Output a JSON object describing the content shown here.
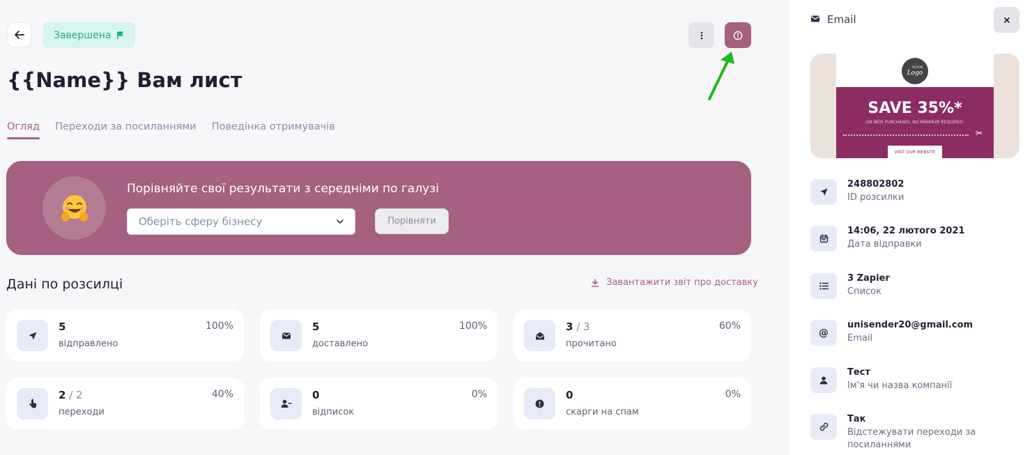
{
  "header": {
    "status": "Завершена",
    "title": "{{Name}} Вам лист"
  },
  "tabs": [
    {
      "label": "Огляд",
      "active": true
    },
    {
      "label": "Переходи за посиланнями",
      "active": false
    },
    {
      "label": "Поведінка отримувачів",
      "active": false
    }
  ],
  "banner": {
    "title": "Порівняйте свої результати з середніми по галузі",
    "select_placeholder": "Оберіть сферу бізнесу",
    "compare_label": "Порівняти"
  },
  "stats": {
    "title": "Дані по розсилці",
    "download_label": "Завантажити звіт про доставку",
    "cards": [
      {
        "value": "5",
        "sub": "",
        "label": "відправлено",
        "pct": "100%",
        "icon": "send-icon"
      },
      {
        "value": "5",
        "sub": "",
        "label": "доставлено",
        "pct": "100%",
        "icon": "envelope-icon"
      },
      {
        "value": "3",
        "sub": " / 3",
        "label": "прочитано",
        "pct": "60%",
        "icon": "envelope-open-icon"
      },
      {
        "value": "2",
        "sub": " / 2",
        "label": "переходи",
        "pct": "40%",
        "icon": "pointer-icon"
      },
      {
        "value": "0",
        "sub": "",
        "label": "відписок",
        "pct": "0%",
        "icon": "user-minus-icon"
      },
      {
        "value": "0",
        "sub": "",
        "label": "скарги на спам",
        "pct": "0%",
        "icon": "alert-icon"
      }
    ]
  },
  "side": {
    "header": "Email",
    "preview": {
      "logo": "Logo",
      "logo_small": "YOUR",
      "promo_title": "SAVE 35%*",
      "promo_sub": "ON NEW PURCHASES. NO MINIMUM REQUIRED.",
      "promo_button": "VISIT OUR WEBSITE"
    },
    "rows": [
      {
        "value": "248802802",
        "label": "ID розсилки",
        "icon": "send-icon"
      },
      {
        "value": "14:06, 22 лютого 2021",
        "label": "Дата відправки",
        "icon": "calendar-icon"
      },
      {
        "value": "3 Zapier",
        "label": "Список",
        "icon": "list-icon"
      },
      {
        "value": "unisender20@gmail.com",
        "label": "Email",
        "icon": "at-icon"
      },
      {
        "value": "Тест",
        "label": "Ім'я чи назва компанії",
        "icon": "user-icon"
      },
      {
        "value": "Так",
        "label": "Відстежувати переходи за посиланнями",
        "icon": "link-icon"
      }
    ]
  },
  "colors": {
    "accent": "#a5617f",
    "status_bg": "#d7f5ee",
    "status_text": "#1fae8c"
  }
}
